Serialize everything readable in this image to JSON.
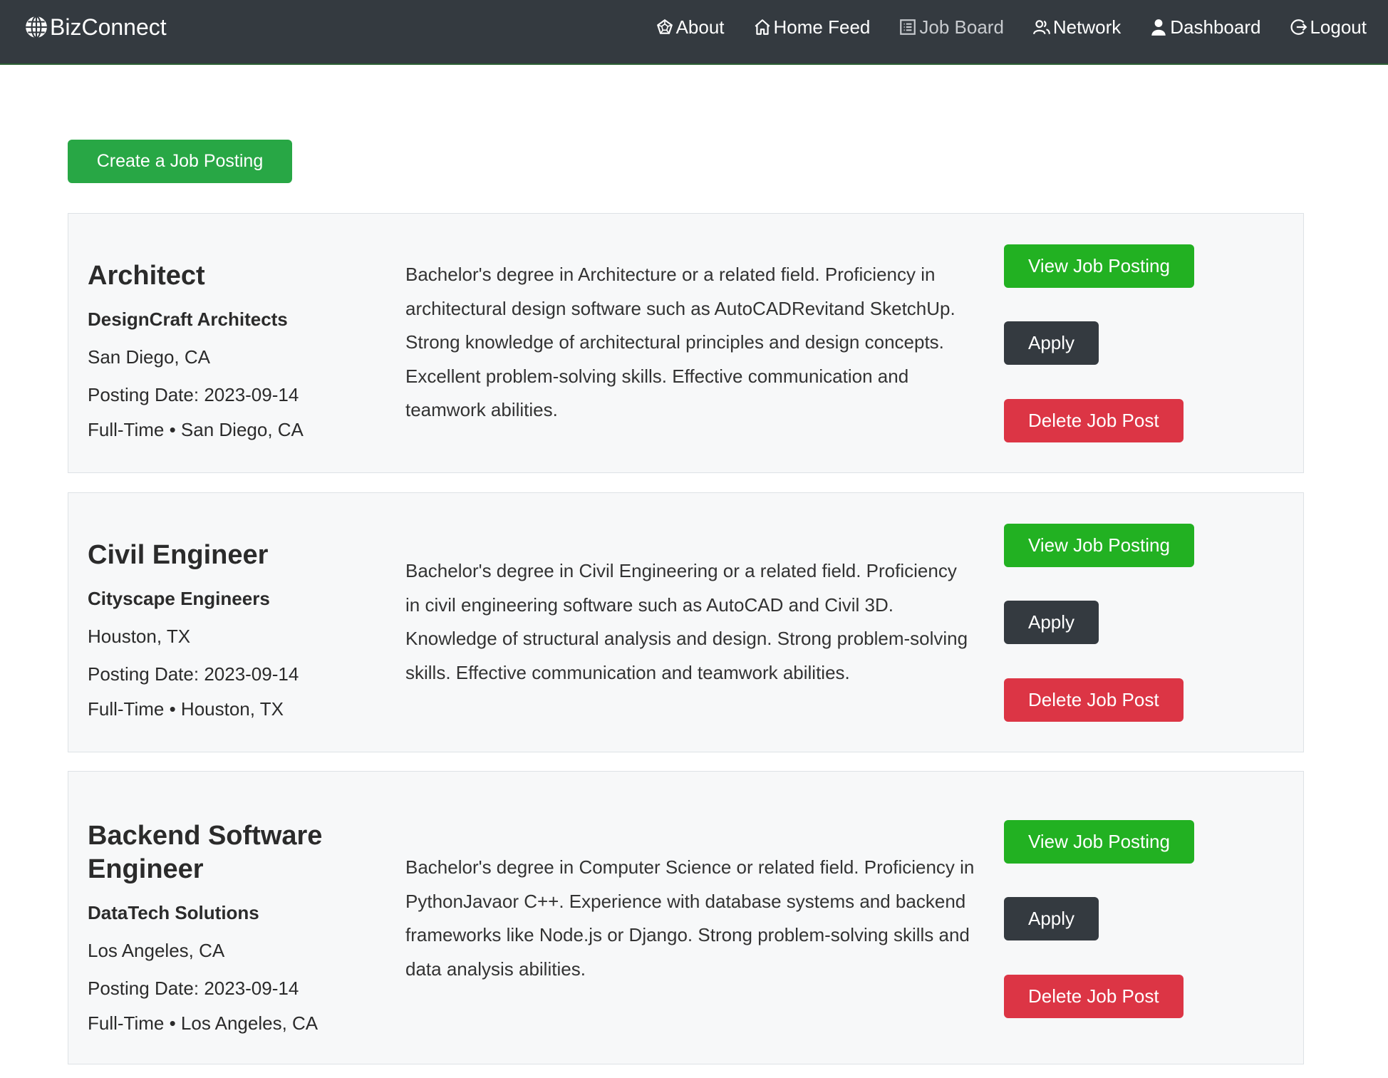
{
  "navbar": {
    "brand": "BizConnect",
    "links": [
      {
        "label": "About",
        "icon": "pentagon-web-icon"
      },
      {
        "label": "Home Feed",
        "icon": "house-icon"
      },
      {
        "label": "Job Board",
        "icon": "list-board-icon",
        "active": true
      },
      {
        "label": "Network",
        "icon": "people-icon"
      },
      {
        "label": "Dashboard",
        "icon": "person-icon"
      },
      {
        "label": "Logout",
        "icon": "logout-icon"
      }
    ]
  },
  "create_button": "Create a Job Posting",
  "jobs": [
    {
      "title": "Architect",
      "company": "DesignCraft Architects",
      "location": "San Diego, CA",
      "posting_date": "Posting Date: 2023-09-14",
      "type_line": "Full-Time • San Diego, CA",
      "description": "Bachelor's degree in Architecture or a related field. Proficiency in architectural design software such as AutoCADRevitand SketchUp. Strong knowledge of architectural principles and design concepts. Excellent problem-solving skills. Effective communication and teamwork abilities.",
      "view_label": "View Job Posting",
      "apply_label": "Apply",
      "delete_label": "Delete Job Post"
    },
    {
      "title": "Civil Engineer",
      "company": "Cityscape Engineers",
      "location": "Houston, TX",
      "posting_date": "Posting Date: 2023-09-14",
      "type_line": "Full-Time • Houston, TX",
      "description": "Bachelor's degree in Civil Engineering or a related field. Proficiency in civil engineering software such as AutoCAD and Civil 3D. Knowledge of structural analysis and design. Strong problem-solving skills. Effective communication and teamwork abilities.",
      "view_label": "View Job Posting",
      "apply_label": "Apply",
      "delete_label": "Delete Job Post"
    },
    {
      "title": "Backend Software Engineer",
      "company": "DataTech Solutions",
      "location": "Los Angeles, CA",
      "posting_date": "Posting Date: 2023-09-14",
      "type_line": "Full-Time • Los Angeles, CA",
      "description": "Bachelor's degree in Computer Science or related field. Proficiency in PythonJavaor C++. Experience with database systems and backend frameworks like Node.js or Django. Strong problem-solving skills and data analysis abilities.",
      "view_label": "View Job Posting",
      "apply_label": "Apply",
      "delete_label": "Delete Job Post"
    }
  ],
  "colors": {
    "navbar": "#343a40",
    "success": "#28a745",
    "view": "#22b122",
    "dark": "#343a40",
    "danger": "#dc3545",
    "card_bg": "#f7f8f9"
  }
}
